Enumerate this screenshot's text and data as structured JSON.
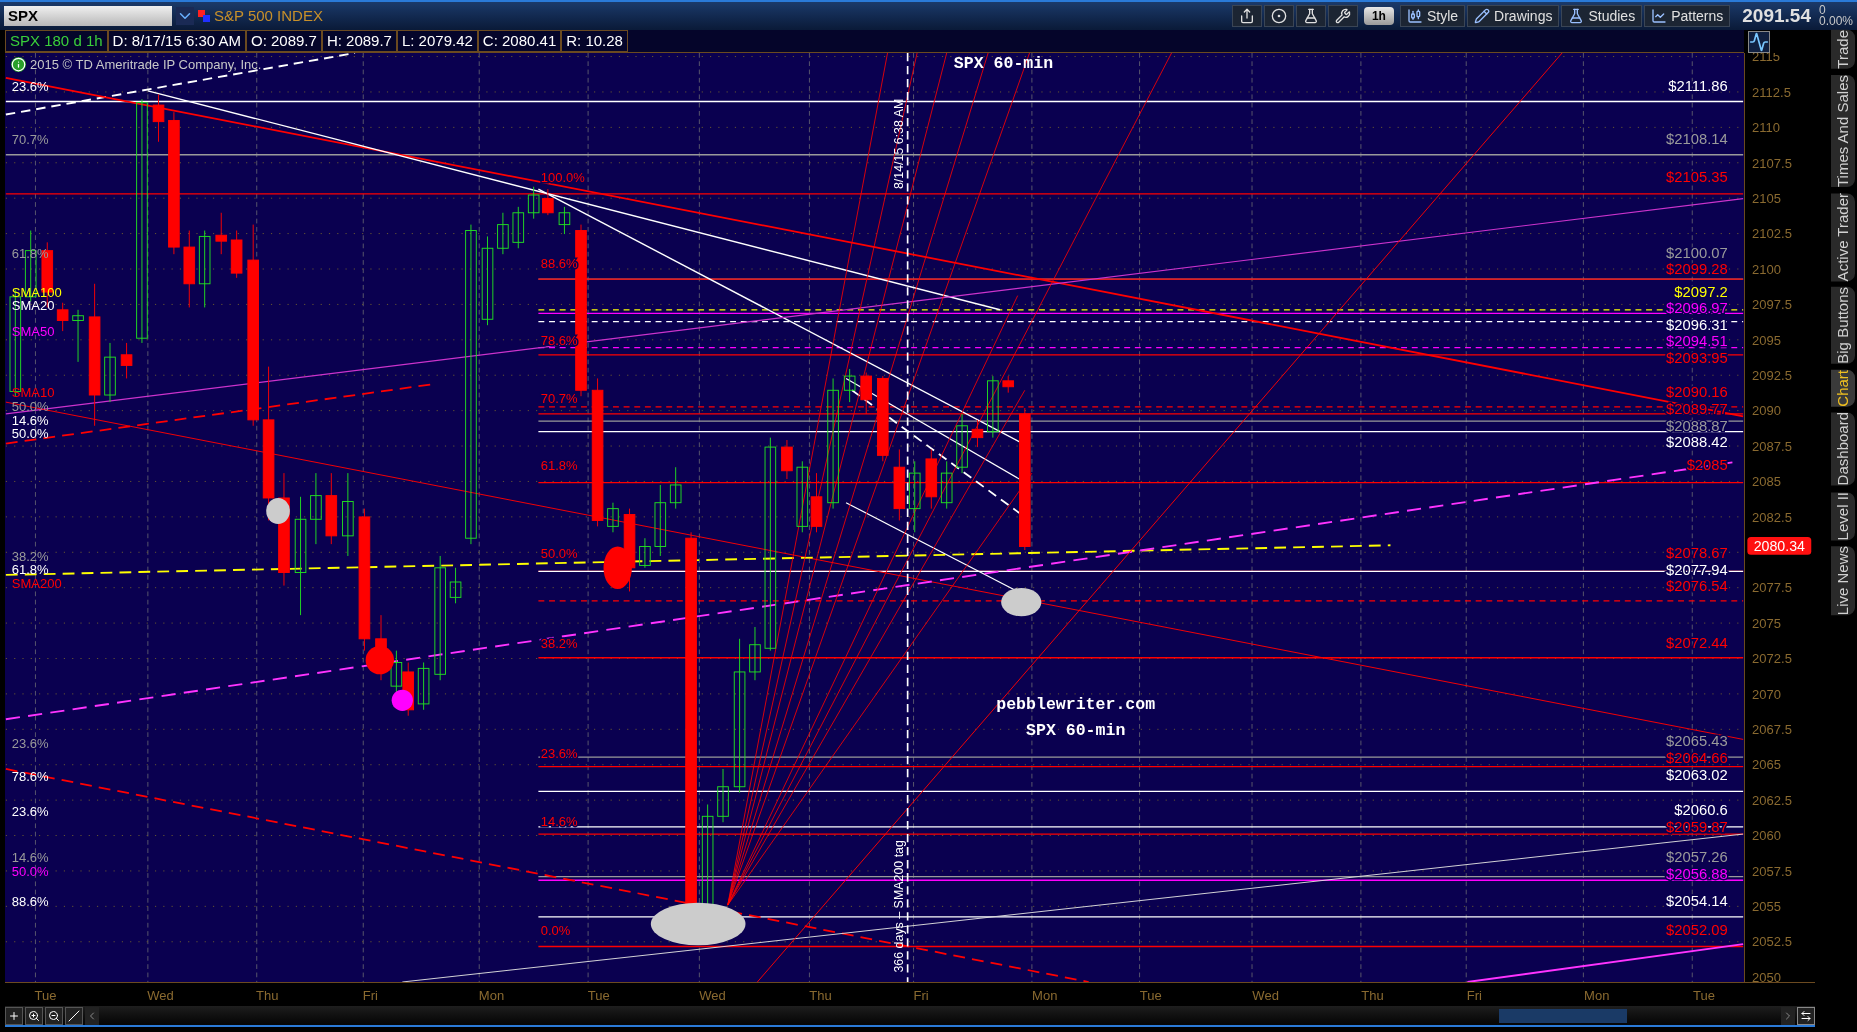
{
  "symbol_bar": {
    "symbol": "SPX",
    "description": "S&P 500 INDEX"
  },
  "toolbar": {
    "interval": "1h",
    "buttons": [
      "Style",
      "Drawings",
      "Studies",
      "Patterns"
    ],
    "last_price": "2091.54",
    "change": "0",
    "change_percent": "0.00%"
  },
  "info_bar": {
    "study": "SPX 180 d 1h",
    "fields": [
      "D: 8/17/15 6:30 AM",
      "O: 2089.7",
      "H: 2089.7",
      "L: 2079.42",
      "C: 2080.41",
      "R: 10.28"
    ]
  },
  "chart": {
    "copyright": "2015 © TD Ameritrade IP Company, Inc.",
    "top_note": "SPX 60-min",
    "notes": [
      "pebblewriter.com",
      "SPX 60-min"
    ],
    "vertical_notes": [
      "8/14/15 6:38 AM",
      "366 days – SMA200 tag"
    ],
    "left_labels": [
      {
        "text": "23.6%",
        "color": "#ffffff"
      },
      {
        "text": "70.7%",
        "color": "#9a9a9a"
      },
      {
        "text": "61.8%",
        "color": "#9a9a9a"
      },
      {
        "text": "SMA100",
        "color": "#ffff00"
      },
      {
        "text": "SMA20",
        "color": "#ffffff"
      },
      {
        "text": "SMA50",
        "color": "#ff00ff"
      },
      {
        "text": "SMA10",
        "color": "#ff0000"
      },
      {
        "text": "50.0%",
        "color": "#9a9a9a"
      },
      {
        "text": "14.6%",
        "color": "#ffffff"
      },
      {
        "text": "50.0%",
        "color": "#ffffff"
      },
      {
        "text": "38.2%",
        "color": "#9a9a9a"
      },
      {
        "text": "61.8%",
        "color": "#ffffff"
      },
      {
        "text": "SMA200",
        "color": "#ff0000"
      },
      {
        "text": "23.6%",
        "color": "#9a9a9a"
      },
      {
        "text": "78.6%",
        "color": "#ffffff"
      },
      {
        "text": "23.6%",
        "color": "#ffffff"
      },
      {
        "text": "14.6%",
        "color": "#9a9a9a"
      },
      {
        "text": "50.0%",
        "color": "#ff00ff"
      },
      {
        "text": "88.6%",
        "color": "#ffffff"
      }
    ],
    "fib_labels": [
      "100.0%",
      "88.6%",
      "78.6%",
      "70.7%",
      "61.8%",
      "50.0%",
      "38.2%",
      "23.6%",
      "14.6%",
      "0.0%"
    ],
    "price_labels": [
      {
        "text": "$2111.86",
        "color": "#ffffff"
      },
      {
        "text": "$2108.14",
        "color": "#9a9a9a"
      },
      {
        "text": "$2105.35",
        "color": "#ff0000"
      },
      {
        "text": "$2100.07",
        "color": "#9a9a9a"
      },
      {
        "text": "$2099.28",
        "color": "#ff0000"
      },
      {
        "text": "$2097.2",
        "color": "#ffff00"
      },
      {
        "text": "$2096.97",
        "color": "#ff00ff"
      },
      {
        "text": "$2096.31",
        "color": "#ffffff"
      },
      {
        "text": "$2094.51",
        "color": "#ff00ff"
      },
      {
        "text": "$2093.95",
        "color": "#ff0000"
      },
      {
        "text": "$2090.16",
        "color": "#ff0000"
      },
      {
        "text": "$2089.77",
        "color": "#ff0000"
      },
      {
        "text": "$2088.87",
        "color": "#9a9a9a"
      },
      {
        "text": "$2088.42",
        "color": "#ffffff"
      },
      {
        "text": "$2085",
        "color": "#ff0000"
      },
      {
        "text": "$2078.67",
        "color": "#ff0000"
      },
      {
        "text": "$2077.94",
        "color": "#ffffff"
      },
      {
        "text": "$2076.54",
        "color": "#ff0000"
      },
      {
        "text": "$2072.44",
        "color": "#ff0000"
      },
      {
        "text": "$2065.43",
        "color": "#9a9a9a"
      },
      {
        "text": "$2064.66",
        "color": "#ff0000"
      },
      {
        "text": "$2063.02",
        "color": "#ffffff"
      },
      {
        "text": "$2060.6",
        "color": "#ffffff"
      },
      {
        "text": "$2059.87",
        "color": "#ff0000"
      },
      {
        "text": "$2057.26",
        "color": "#9a9a9a"
      },
      {
        "text": "$2056.88",
        "color": "#ff00ff"
      },
      {
        "text": "$2054.14",
        "color": "#ffffff"
      },
      {
        "text": "$2052.09",
        "color": "#ff0000"
      }
    ]
  },
  "y_axis": {
    "ticks": [
      "2115",
      "2112.5",
      "2110",
      "2107.5",
      "2105",
      "2102.5",
      "2100",
      "2097.5",
      "2095",
      "2092.5",
      "2090",
      "2087.5",
      "2085",
      "2082.5",
      "2077.5",
      "2075",
      "2072.5",
      "2070",
      "2067.5",
      "2065",
      "2062.5",
      "2060",
      "2057.5",
      "2055",
      "2052.5",
      "2050"
    ],
    "current_price": "2080.34"
  },
  "x_axis": {
    "labels": [
      "Tue",
      "Wed",
      "Thu",
      "Fri",
      "Mon",
      "Tue",
      "Wed",
      "Thu",
      "Fri",
      "Mon",
      "Tue",
      "Wed",
      "Thu",
      "Fri",
      "Mon",
      "Tue"
    ]
  },
  "sidebar_tabs": [
    {
      "label": "Trade",
      "selected": false
    },
    {
      "label": "Times And Sales",
      "selected": false
    },
    {
      "label": "Active Trader",
      "selected": false
    },
    {
      "label": "Big Buttons",
      "selected": false
    },
    {
      "label": "Chart",
      "selected": true
    },
    {
      "label": "Dashboard",
      "selected": false
    },
    {
      "label": "Level II",
      "selected": false
    },
    {
      "label": "Live News",
      "selected": false
    }
  ]
}
